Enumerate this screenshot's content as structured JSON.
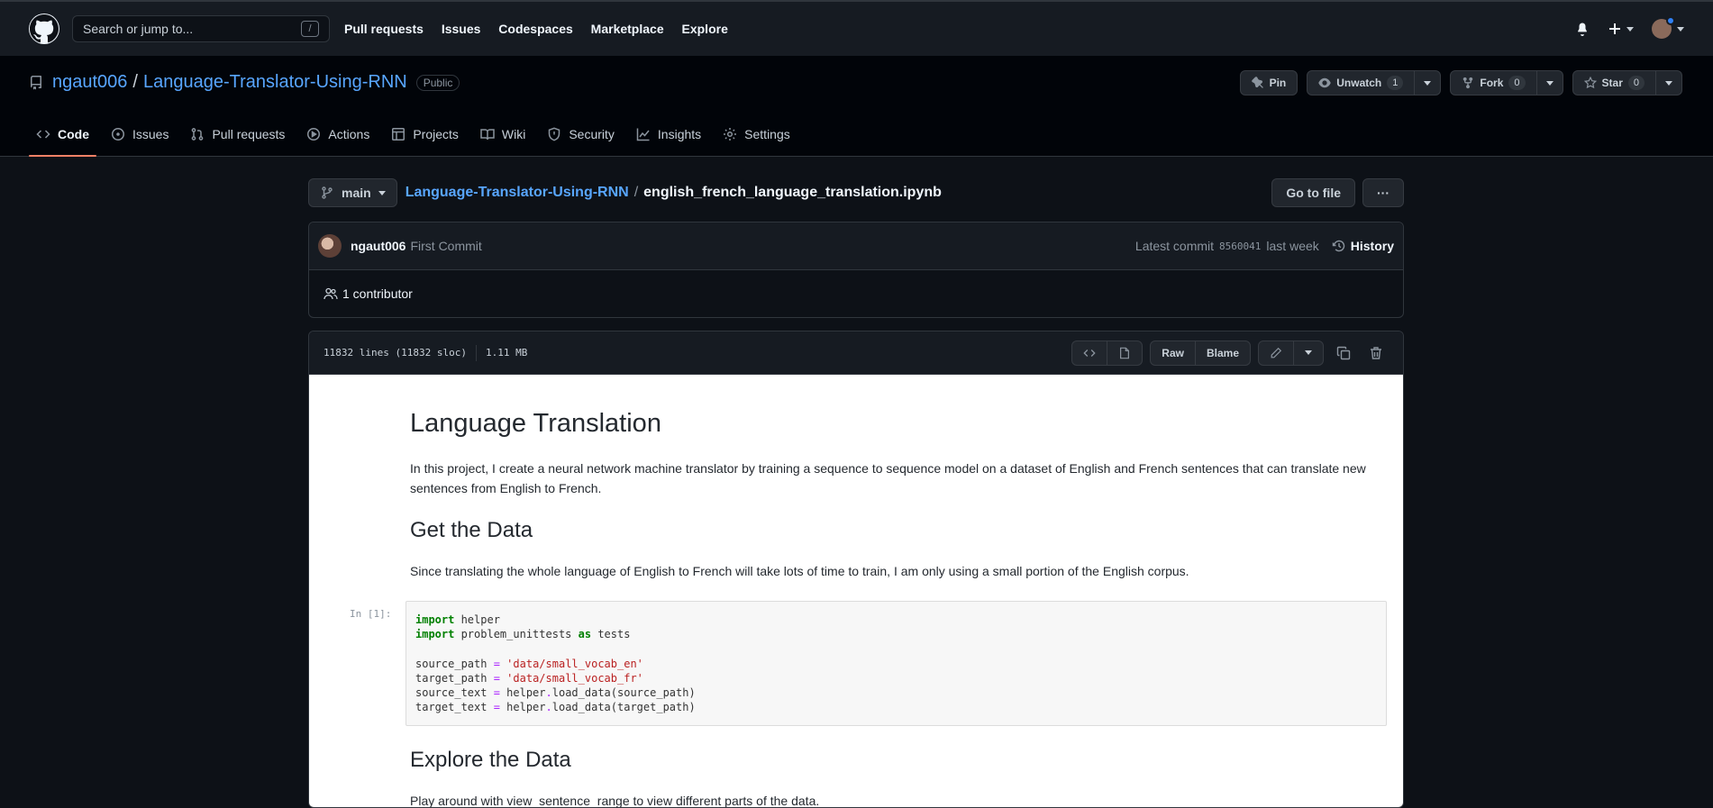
{
  "header": {
    "search_placeholder": "Search or jump to...",
    "search_key": "/",
    "nav": [
      "Pull requests",
      "Issues",
      "Codespaces",
      "Marketplace",
      "Explore"
    ]
  },
  "repo": {
    "owner": "ngaut006",
    "sep": "/",
    "name": "Language-Translator-Using-RNN",
    "visibility": "Public",
    "pin_label": "Pin",
    "unwatch_label": "Unwatch",
    "watch_count": "1",
    "fork_label": "Fork",
    "fork_count": "0",
    "star_label": "Star",
    "star_count": "0",
    "tabs": [
      "Code",
      "Issues",
      "Pull requests",
      "Actions",
      "Projects",
      "Wiki",
      "Security",
      "Insights",
      "Settings"
    ]
  },
  "file_nav": {
    "branch": "main",
    "crumb_repo": "Language-Translator-Using-RNN",
    "crumb_sep": "/",
    "crumb_file": "english_french_language_translation.ipynb",
    "go_to_file": "Go to file",
    "more": "···"
  },
  "commit": {
    "author": "ngaut006",
    "message": "First Commit",
    "latest_label": "Latest commit",
    "sha": "8560041",
    "time": "last week",
    "history_label": "History",
    "contributors": "1 contributor"
  },
  "file": {
    "lines": "11832 lines (11832 sloc)",
    "size": "1.11 MB",
    "raw_label": "Raw",
    "blame_label": "Blame"
  },
  "notebook": {
    "title": "Language Translation",
    "intro": "In this project, I create a neural network machine translator by training a sequence to sequence model on a dataset of English and French sentences that can translate new sentences from English to French.",
    "h_get_data": "Get the Data",
    "p_get_data": "Since translating the whole language of English to French will take lots of time to train, I am only using a small portion of the English corpus.",
    "cell_prompt": "In [1]:",
    "h_explore": "Explore the Data",
    "p_explore": "Play around with view_sentence_range to view different parts of the data."
  },
  "colors": {
    "accent_blue": "#58a6ff",
    "tab_underline": "#f78166",
    "bg": "#0d1117"
  }
}
